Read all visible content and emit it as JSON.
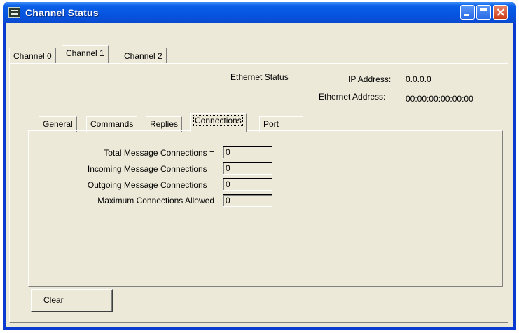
{
  "window": {
    "title": "Channel Status"
  },
  "outer_tabs": [
    "Channel 0",
    "Channel 1",
    "Channel 2"
  ],
  "outer_tabs_active": "Channel 1",
  "ethernet": {
    "status_label": "Ethernet Status",
    "ip_label": "IP Address:",
    "ip_value": "0.0.0.0",
    "mac_label": "Ethernet Address:",
    "mac_value": "00:00:00:00:00:00"
  },
  "inner_tabs": [
    "General",
    "Commands",
    "Replies",
    "Connections",
    "Port"
  ],
  "inner_tabs_active": "Connections",
  "connections": [
    {
      "label": "Total Message Connections =",
      "value": "0"
    },
    {
      "label": "Incoming Message Connections =",
      "value": "0"
    },
    {
      "label": "Outgoing Message Connections =",
      "value": "0"
    },
    {
      "label": "Maximum Connections Allowed",
      "value": "0"
    }
  ],
  "buttons": {
    "clear_accel": "C",
    "clear_rest": "lear"
  }
}
